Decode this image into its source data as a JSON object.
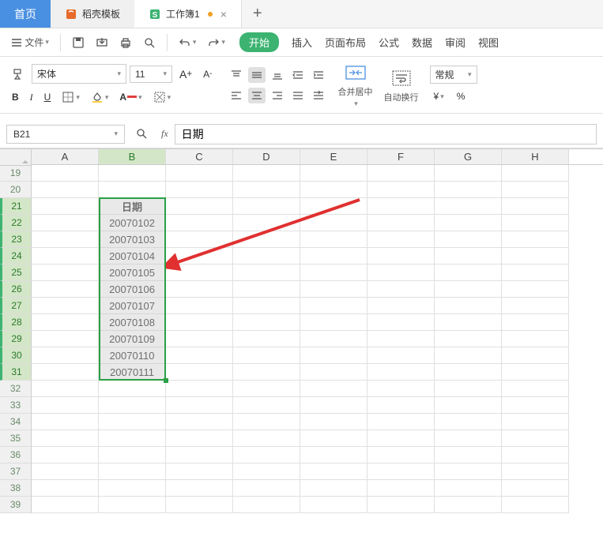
{
  "tabs": {
    "home": "首页",
    "template": "稻壳模板",
    "workbook": "工作簿1"
  },
  "file_menu": "文件",
  "ribbon": {
    "start": "开始",
    "insert": "插入",
    "page_layout": "页面布局",
    "formula": "公式",
    "data": "数据",
    "review": "审阅",
    "view": "视图"
  },
  "font": {
    "name": "宋体",
    "size": "11"
  },
  "merge_label": "合并居中",
  "wrap_label": "自动换行",
  "number_format": "常规",
  "name_box": "B21",
  "formula_value": "日期",
  "columns": [
    "A",
    "B",
    "C",
    "D",
    "E",
    "F",
    "G",
    "H"
  ],
  "chart_data": {
    "type": "table",
    "selection": "B21:B31",
    "first_row_index": 19,
    "row_count": 21,
    "header_col": "B",
    "data_col": "B",
    "rows": [
      {
        "row": 21,
        "value": "日期"
      },
      {
        "row": 22,
        "value": "20070102"
      },
      {
        "row": 23,
        "value": "20070103"
      },
      {
        "row": 24,
        "value": "20070104"
      },
      {
        "row": 25,
        "value": "20070105"
      },
      {
        "row": 26,
        "value": "20070106"
      },
      {
        "row": 27,
        "value": "20070107"
      },
      {
        "row": 28,
        "value": "20070108"
      },
      {
        "row": 29,
        "value": "20070109"
      },
      {
        "row": 30,
        "value": "20070110"
      },
      {
        "row": 31,
        "value": "20070111"
      }
    ]
  }
}
